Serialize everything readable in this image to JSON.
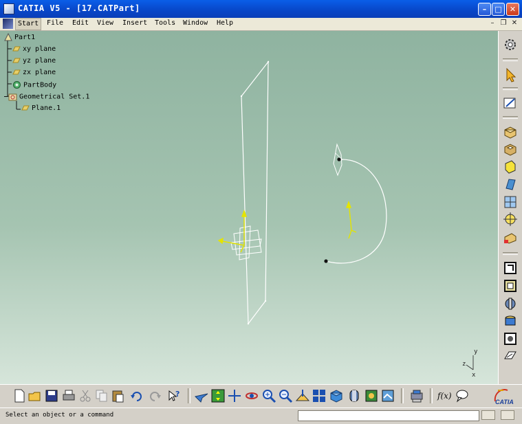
{
  "window": {
    "title": "CATIA V5 - [17.CATPart]"
  },
  "menu": [
    "Start",
    "File",
    "Edit",
    "View",
    "Insert",
    "Tools",
    "Window",
    "Help"
  ],
  "tree": {
    "root": "Part1",
    "items": [
      "xy plane",
      "yz plane",
      "zx plane",
      "PartBody",
      "Geometrical Set.1",
      "Plane.1"
    ]
  },
  "axis": {
    "x": "x",
    "y": "y",
    "z": "z"
  },
  "brand": {
    "logo_text": "CATIA"
  },
  "toolbar": {
    "formula_label": "f(x)",
    "right_tools": [
      "gear-icon",
      "select-arrow-icon",
      "sketcher-icon",
      "pad-icon",
      "pocket-icon",
      "shaft-icon",
      "groove-icon",
      "hole-icon",
      "rib-icon",
      "edge-fillet-icon",
      "draft-icon",
      "shell-icon",
      "thickness-icon",
      "thread-icon",
      "remove-face-icon",
      "replace-face-icon"
    ],
    "bottom_tools": [
      "new-icon",
      "open-icon",
      "save-icon",
      "print-icon",
      "cut-icon",
      "copy-icon",
      "paste-icon",
      "undo-icon",
      "redo-icon",
      "whats-this-icon",
      "fly-mode-icon",
      "fit-all-icon",
      "pan-icon",
      "rotate-icon",
      "zoom-in-icon",
      "zoom-out-icon",
      "normal-view-icon",
      "multi-view-icon",
      "iso-view-icon",
      "shading-icon",
      "hide-show-icon",
      "swap-visible-icon",
      "catalog-icon",
      "formula-icon",
      "knowledge-icon"
    ]
  },
  "status": {
    "message": "Select an object or a command",
    "command_value": ""
  },
  "colors": {
    "title_bar": "#0846c8",
    "viewport_top": "#8fb3a0",
    "viewport_bottom": "#d6e5da",
    "geometry": "#ffffff",
    "axis_yellow": "#e4e400"
  }
}
